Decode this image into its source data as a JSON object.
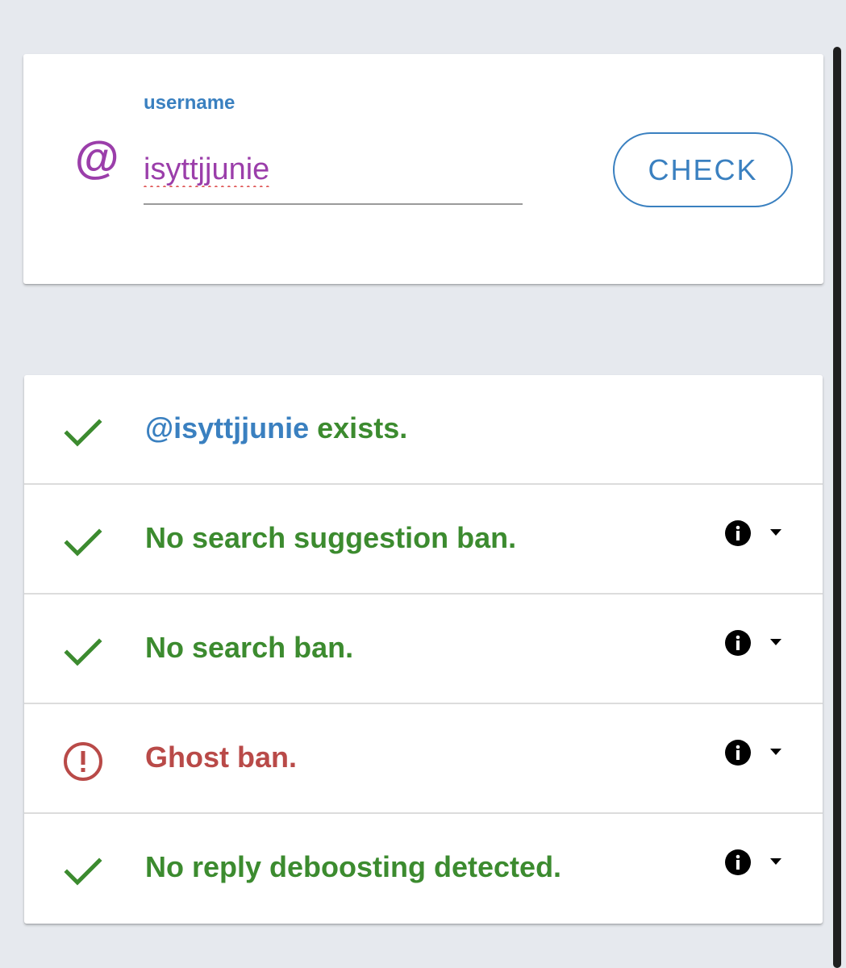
{
  "search": {
    "at_symbol": "@",
    "label": "username",
    "value": "isyttjjunie",
    "button_label": "CHECK"
  },
  "results": {
    "rows": [
      {
        "status": "ok",
        "icon": "checkmark-icon",
        "handle": "@isyttjjunie",
        "text": " exists.",
        "has_info": false
      },
      {
        "status": "ok",
        "icon": "checkmark-icon",
        "text": "No search suggestion ban.",
        "has_info": true
      },
      {
        "status": "ok",
        "icon": "checkmark-icon",
        "text": "No search ban.",
        "has_info": true
      },
      {
        "status": "error",
        "icon": "alert-circle-icon",
        "text": "Ghost ban.",
        "has_info": true
      },
      {
        "status": "ok",
        "icon": "checkmark-icon",
        "text": "No reply deboosting detected.",
        "has_info": true
      }
    ]
  },
  "colors": {
    "accent_blue": "#3a80c0",
    "accent_purple": "#9b3eaa",
    "success_green": "#3c8b2f",
    "error_red": "#b94a48",
    "background": "#e6e9ee"
  }
}
